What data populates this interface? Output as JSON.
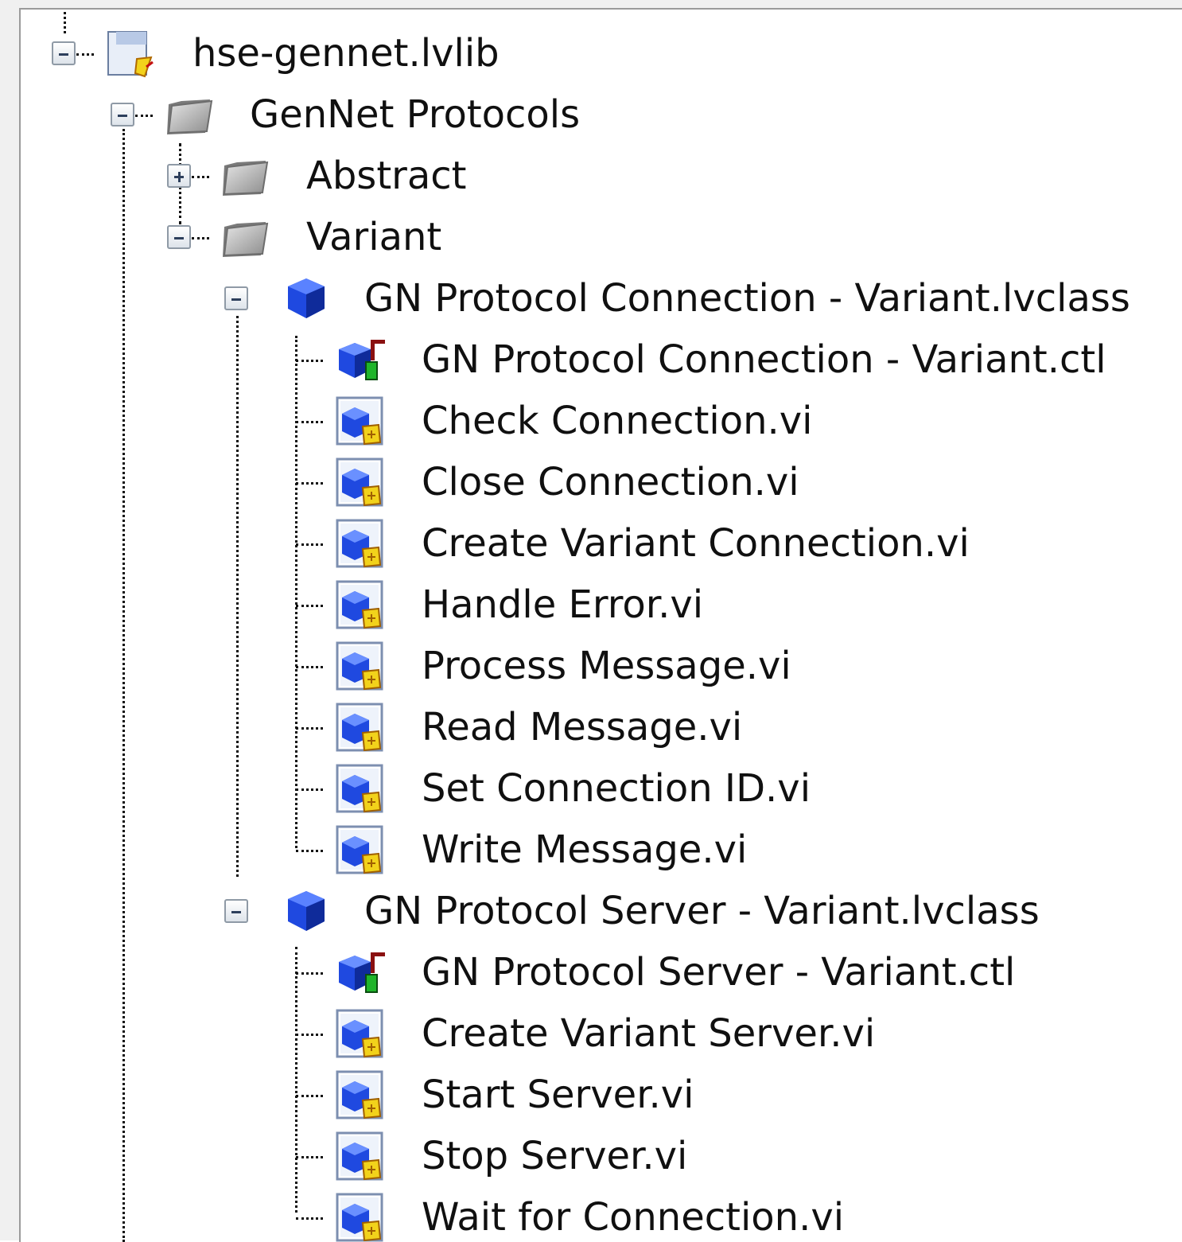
{
  "tree": {
    "library": {
      "label": "hse-gennet.lvlib",
      "expanded": true,
      "icon": "library-icon",
      "folder": {
        "label": "GenNet Protocols",
        "expanded": true,
        "icon": "folder-icon",
        "children": [
          {
            "label": "Abstract",
            "expanded": false,
            "icon": "folder-icon"
          },
          {
            "label": "Variant",
            "expanded": true,
            "icon": "folder-icon"
          }
        ]
      }
    },
    "classes": [
      {
        "label": "GN Protocol Connection - Variant.lvclass",
        "expanded": true,
        "icon": "lvclass-icon",
        "items": [
          {
            "label": "GN Protocol Connection - Variant.ctl",
            "icon": "class-control-icon"
          },
          {
            "label": "Check Connection.vi",
            "icon": "vi-icon"
          },
          {
            "label": "Close Connection.vi",
            "icon": "vi-icon"
          },
          {
            "label": "Create Variant Connection.vi",
            "icon": "vi-icon"
          },
          {
            "label": "Handle Error.vi",
            "icon": "vi-icon"
          },
          {
            "label": "Process Message.vi",
            "icon": "vi-icon"
          },
          {
            "label": "Read Message.vi",
            "icon": "vi-icon"
          },
          {
            "label": "Set Connection ID.vi",
            "icon": "vi-icon"
          },
          {
            "label": "Write Message.vi",
            "icon": "vi-icon"
          }
        ]
      },
      {
        "label": "GN Protocol Server - Variant.lvclass",
        "expanded": true,
        "icon": "lvclass-icon",
        "items": [
          {
            "label": "GN Protocol Server - Variant.ctl",
            "icon": "class-control-icon"
          },
          {
            "label": "Create Variant Server.vi",
            "icon": "vi-icon"
          },
          {
            "label": "Start Server.vi",
            "icon": "vi-icon"
          },
          {
            "label": "Stop Server.vi",
            "icon": "vi-icon"
          },
          {
            "label": "Wait for Connection.vi",
            "icon": "vi-icon"
          }
        ]
      }
    ]
  },
  "colors": {
    "background": "#ffffff",
    "text": "#101010",
    "tree_lines": "#111111",
    "expander_border": "#8f9aa6",
    "folder": "#b5b5b5",
    "class_cube": "#1a3fd6",
    "vi_badge": "#f2d21b"
  }
}
